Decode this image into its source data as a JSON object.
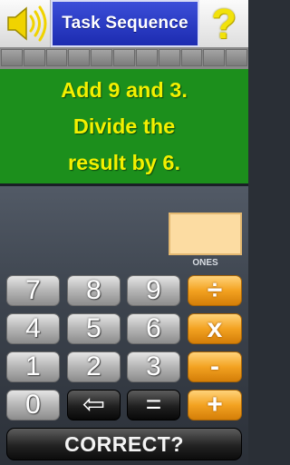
{
  "header": {
    "title": "Task Sequence",
    "help_glyph": "?",
    "sound_icon": "speaker-volume-icon"
  },
  "progress_strip": {
    "cells": 11
  },
  "question": {
    "lines": [
      "Add 9 and 3.",
      "Divide the",
      "result by 6."
    ]
  },
  "answer": {
    "value": "",
    "place_label": "ONES"
  },
  "keypad": {
    "rows": [
      [
        {
          "label": "7",
          "kind": "digit"
        },
        {
          "label": "8",
          "kind": "digit"
        },
        {
          "label": "9",
          "kind": "digit"
        },
        {
          "label": "÷",
          "kind": "operator"
        }
      ],
      [
        {
          "label": "4",
          "kind": "digit"
        },
        {
          "label": "5",
          "kind": "digit"
        },
        {
          "label": "6",
          "kind": "digit"
        },
        {
          "label": "x",
          "kind": "operator"
        }
      ],
      [
        {
          "label": "1",
          "kind": "digit"
        },
        {
          "label": "2",
          "kind": "digit"
        },
        {
          "label": "3",
          "kind": "digit"
        },
        {
          "label": "-",
          "kind": "operator"
        }
      ],
      [
        {
          "label": "0",
          "kind": "digit"
        },
        {
          "label": "⇦",
          "kind": "backspace"
        },
        {
          "label": "=",
          "kind": "equals"
        },
        {
          "label": "+",
          "kind": "operator"
        }
      ]
    ]
  },
  "submit": {
    "label": "CORRECT?"
  },
  "colors": {
    "title_bg": "#2436c4",
    "question_bg": "#1c8f1c",
    "question_text": "#f3f000",
    "answer_bg": "#fcdca2",
    "operator_key": "#f3a221",
    "help_glyph": "#f2e20a"
  }
}
